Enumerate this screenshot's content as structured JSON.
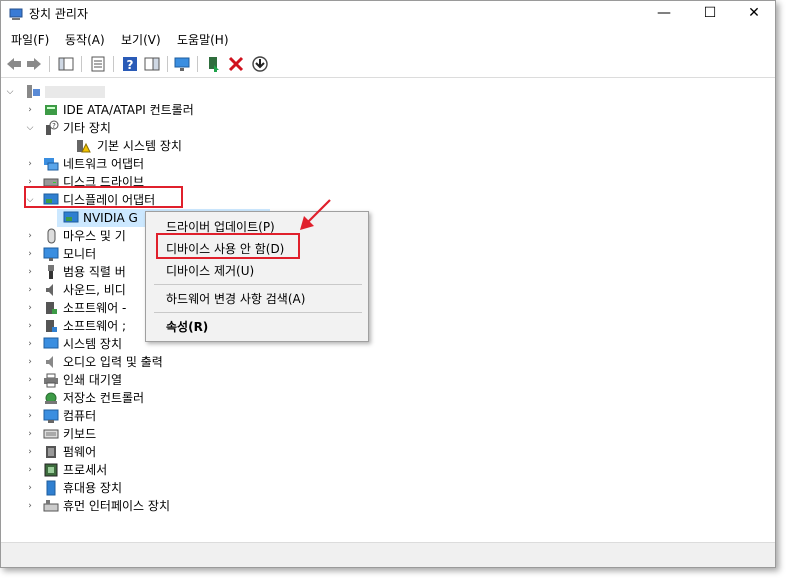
{
  "window": {
    "title": "장치 관리자",
    "minimize": "—",
    "maximize": "☐",
    "close": "✕"
  },
  "menu": [
    "파일(F)",
    "동작(A)",
    "보기(V)",
    "도움말(H)"
  ],
  "root_label": "",
  "tree": [
    {
      "label": "IDE ATA/ATAPI 컨트롤러",
      "expanded": false,
      "icon": "ide-controller-icon"
    },
    {
      "label": "기타 장치",
      "expanded": true,
      "icon": "other-devices-icon"
    },
    {
      "label": "기본 시스템 장치",
      "child": true,
      "icon": "warning-device-icon"
    },
    {
      "label": "네트워크 어댑터",
      "expanded": false,
      "icon": "network-adapter-icon"
    },
    {
      "label": "디스크 드라이브",
      "expanded": false,
      "icon": "disk-drive-icon"
    },
    {
      "label": "디스플레이 어댑터",
      "expanded": true,
      "icon": "display-adapter-icon"
    },
    {
      "label": "NVIDIA G",
      "child": true,
      "icon": "gpu-device-icon"
    },
    {
      "label": "마우스 및 기",
      "expanded": false,
      "icon": "mouse-icon"
    },
    {
      "label": "모니터",
      "expanded": false,
      "icon": "monitor-icon"
    },
    {
      "label": "범용 직렬 버",
      "expanded": false,
      "icon": "usb-icon"
    },
    {
      "label": "사운드, 비디",
      "expanded": false,
      "icon": "sound-icon"
    },
    {
      "label": "소프트웨어 -",
      "expanded": false,
      "icon": "software-component-icon"
    },
    {
      "label": "소프트웨어 ;",
      "expanded": false,
      "icon": "software-device-icon"
    },
    {
      "label": "시스템 장치",
      "expanded": false,
      "icon": "system-device-icon"
    },
    {
      "label": "오디오 입력 및 출력",
      "expanded": false,
      "icon": "audio-io-icon"
    },
    {
      "label": "인쇄 대기열",
      "expanded": false,
      "icon": "print-queue-icon"
    },
    {
      "label": "저장소 컨트롤러",
      "expanded": false,
      "icon": "storage-controller-icon"
    },
    {
      "label": "컴퓨터",
      "expanded": false,
      "icon": "computer-icon"
    },
    {
      "label": "키보드",
      "expanded": false,
      "icon": "keyboard-icon"
    },
    {
      "label": "펌웨어",
      "expanded": false,
      "icon": "firmware-icon"
    },
    {
      "label": "프로세서",
      "expanded": false,
      "icon": "processor-icon"
    },
    {
      "label": "휴대용 장치",
      "expanded": false,
      "icon": "portable-device-icon"
    },
    {
      "label": "휴먼 인터페이스 장치",
      "expanded": false,
      "icon": "hid-icon"
    }
  ],
  "context_menu": {
    "update": "드라이버 업데이트(P)",
    "disable": "디바이스 사용 안 함(D)",
    "uninstall": "디바이스 제거(U)",
    "scan": "하드웨어 변경 사항 검색(A)",
    "properties": "속성(R)"
  },
  "colors": {
    "highlight": "#e0202c",
    "selection": "#cce8ff",
    "accent": "#1e6fc8"
  }
}
